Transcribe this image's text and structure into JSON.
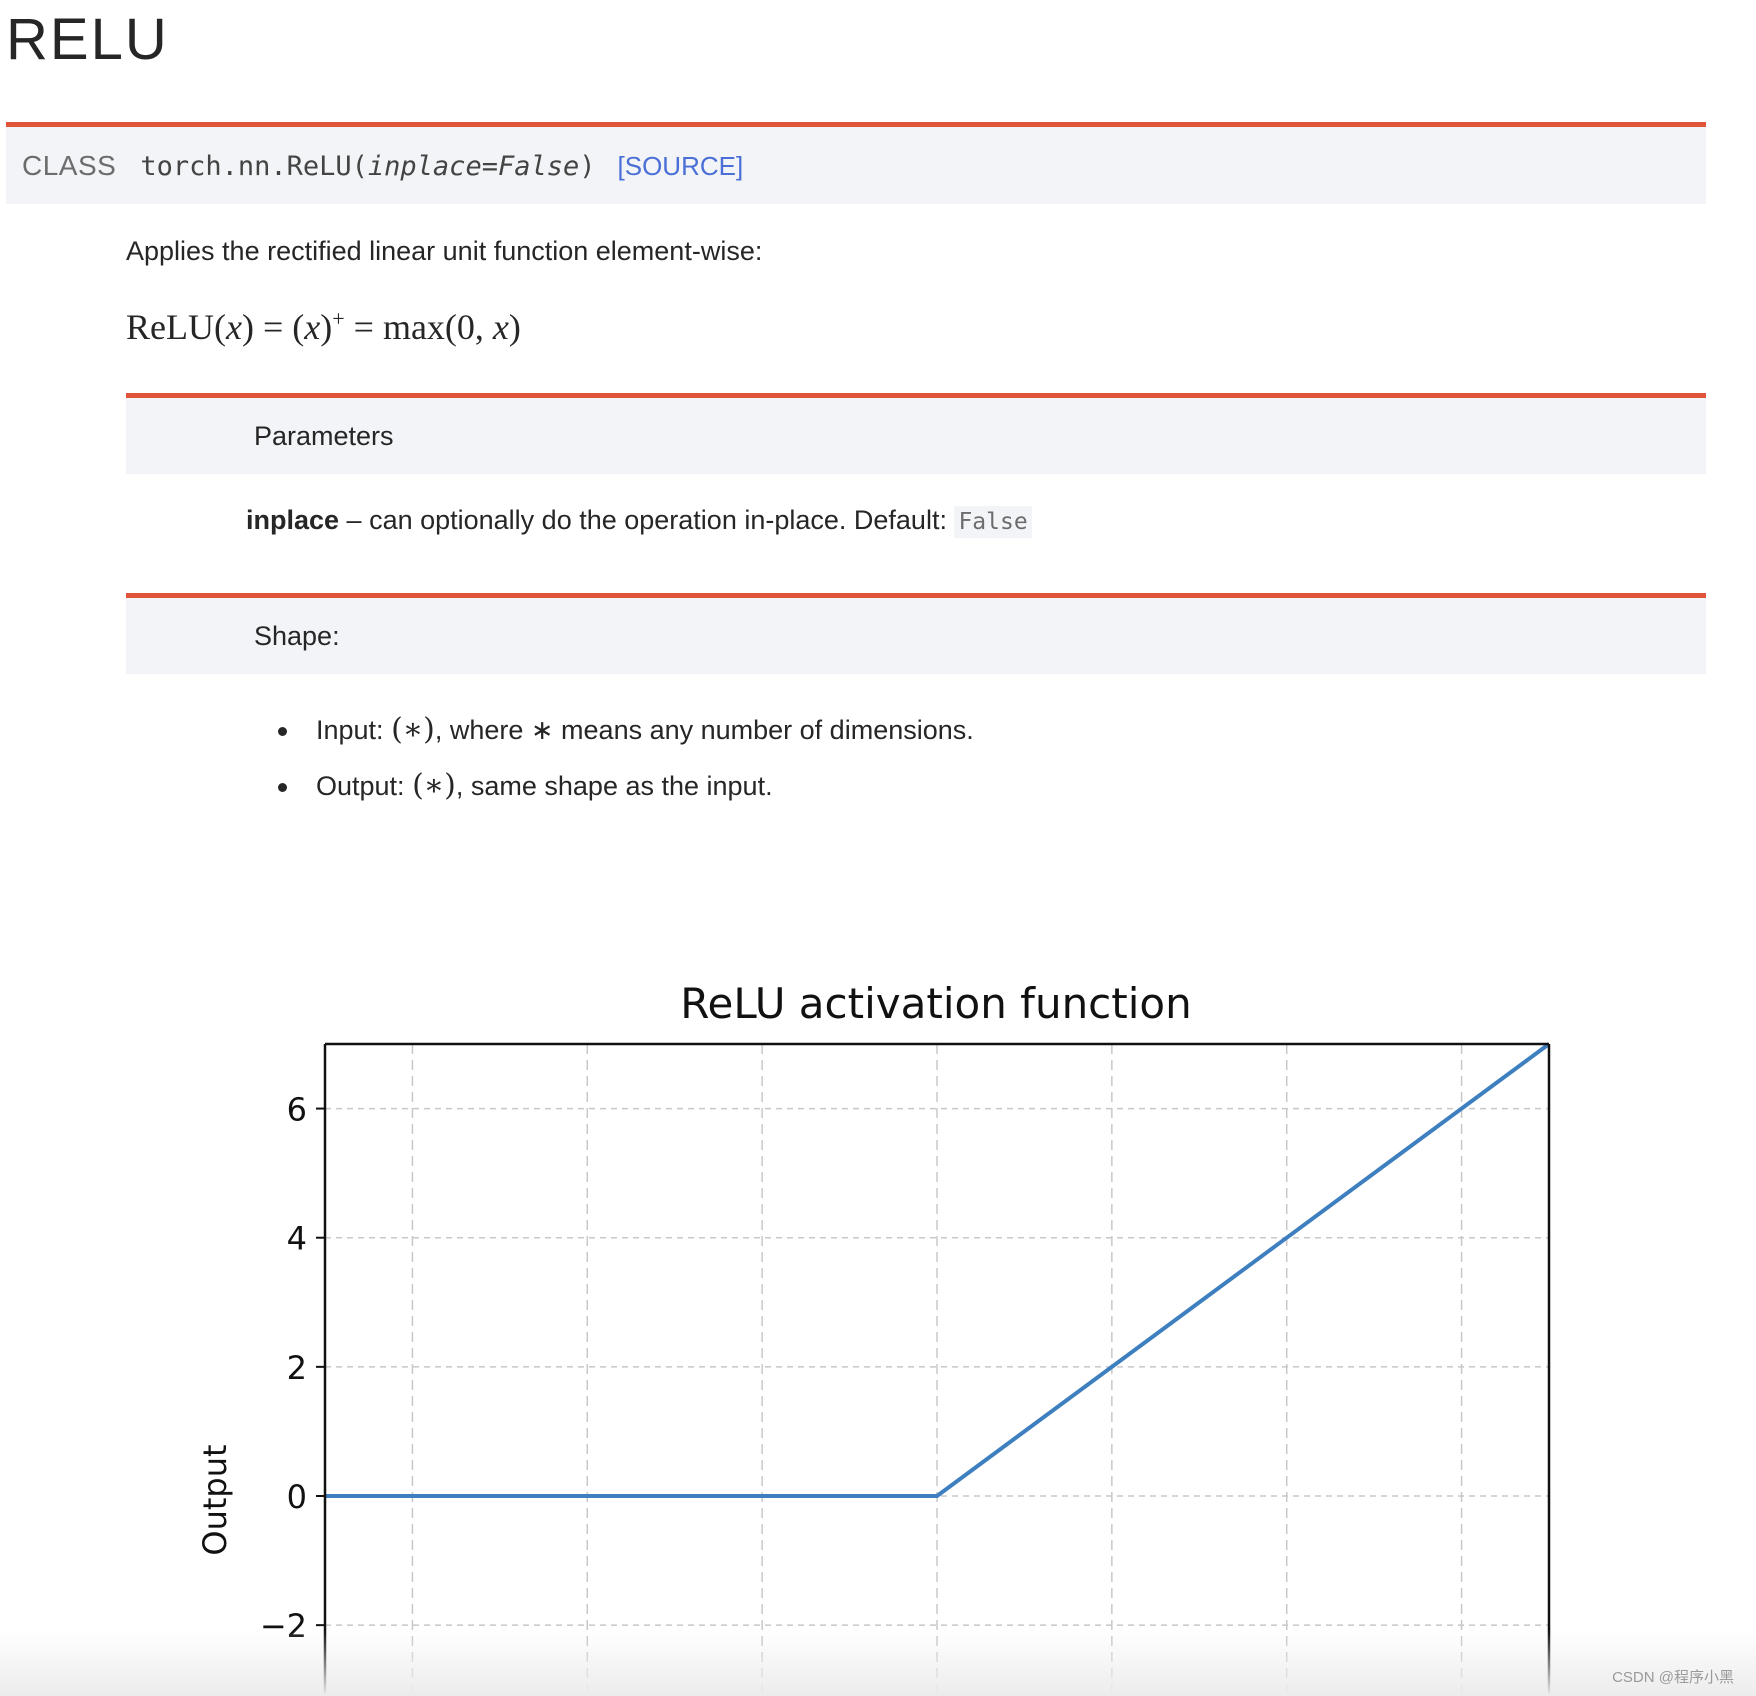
{
  "page": {
    "title": "RELU",
    "signature": {
      "class_label": "CLASS",
      "name": "torch.nn.ReLU(",
      "param": "inplace=False",
      "close": ")",
      "source_link": "[SOURCE]"
    },
    "description": "Applies the rectified linear unit function element-wise:",
    "formula": {
      "lhs": "ReLU(",
      "x": "x",
      "rhs1": ") = (",
      "rhs2": ")",
      "sup": "+",
      "rhs3": " = max(0, ",
      "rhs4": ")"
    },
    "parameters": {
      "heading": "Parameters",
      "name": "inplace",
      "desc": " – can optionally do the operation in-place. Default: ",
      "default": "False"
    },
    "shape": {
      "heading": "Shape:",
      "items": [
        {
          "label": "Input: ",
          "math": "(∗)",
          "text": ", where ∗ means any number of dimensions."
        },
        {
          "label": "Output: ",
          "math": "(∗)",
          "text": ", same shape as the input."
        }
      ]
    },
    "watermark": "CSDN @程序小黑"
  },
  "chart_data": {
    "type": "line",
    "title": "ReLU activation function",
    "xlabel": "",
    "ylabel": "Output",
    "xlim": [
      -7,
      7
    ],
    "ylim": [
      -7,
      7
    ],
    "yticks": [
      -2,
      0,
      2,
      4,
      6
    ],
    "yticklabels": [
      "−2",
      "0",
      "2",
      "4",
      "6"
    ],
    "xgrid": [
      -6,
      -4,
      -2,
      0,
      2,
      4,
      6
    ],
    "grid": true,
    "series": [
      {
        "x": [
          -7,
          0,
          7
        ],
        "y": [
          0,
          0,
          7
        ],
        "color": "#3d7fbf"
      }
    ]
  }
}
